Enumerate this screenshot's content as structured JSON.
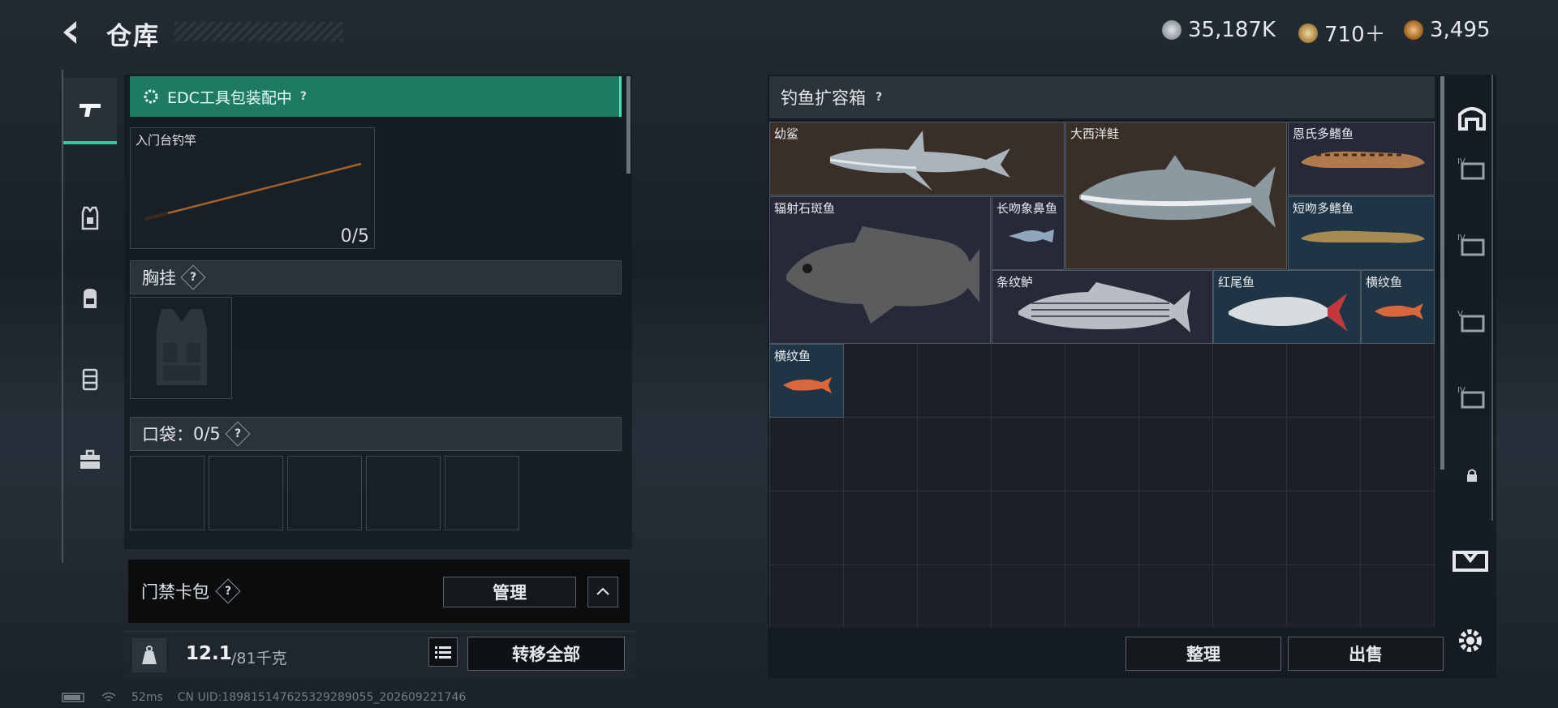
{
  "header": {
    "title": "仓库",
    "currencies": [
      {
        "icon": "silver-coin-icon",
        "value": "35,187K",
        "color": "#b9bec3"
      },
      {
        "icon": "bronze-token-icon",
        "value": "710＋",
        "color": "#c9a66b"
      },
      {
        "icon": "gold-coin-icon",
        "value": "3,495",
        "color": "#c78a3b"
      }
    ]
  },
  "left_nav": [
    "pistol-icon",
    "armor-vest-icon",
    "backpack-icon",
    "rig-icon",
    "toolbox-icon"
  ],
  "loadout": {
    "edc_label": "EDC工具包装配中",
    "rod": {
      "name": "入门台钓竿",
      "count": "0/5"
    },
    "chest_rig": {
      "label": "胸挂"
    },
    "pockets": {
      "label": "口袋：",
      "count": "0/5"
    },
    "card_pack": {
      "label": "门禁卡包",
      "manage": "管理"
    },
    "weight": {
      "current": "12.1",
      "max": "/81千克"
    },
    "transfer_all": "转移全部"
  },
  "storage": {
    "title": "钓鱼扩容箱",
    "items": [
      {
        "name": "幼鲨",
        "rarity": "brown"
      },
      {
        "name": "大西洋鲑",
        "rarity": "brown"
      },
      {
        "name": "恩氏多鳍鱼",
        "rarity": "purple"
      },
      {
        "name": "辐射石斑鱼",
        "rarity": "purple"
      },
      {
        "name": "长吻象鼻鱼",
        "rarity": "purple"
      },
      {
        "name": "短吻多鳍鱼",
        "rarity": "blue"
      },
      {
        "name": "条纹鲈",
        "rarity": "purple"
      },
      {
        "name": "红尾鱼",
        "rarity": "blue"
      },
      {
        "name": "横纹鱼",
        "rarity": "blue"
      },
      {
        "name": "横纹鱼",
        "rarity": "blue"
      }
    ],
    "organize": "整理",
    "sell": "出售"
  },
  "right_nav": {
    "tabs": [
      "IV",
      "IV",
      "V",
      "IV"
    ]
  },
  "status_bar": {
    "ping": "52ms",
    "uid": "CN UID:189815147625329289055_202609221746"
  },
  "colors": {
    "accent_green": "#1f7a62",
    "rarity_brown": "#3a2f28",
    "rarity_purple": "#272838",
    "rarity_blue": "#1f3444"
  }
}
